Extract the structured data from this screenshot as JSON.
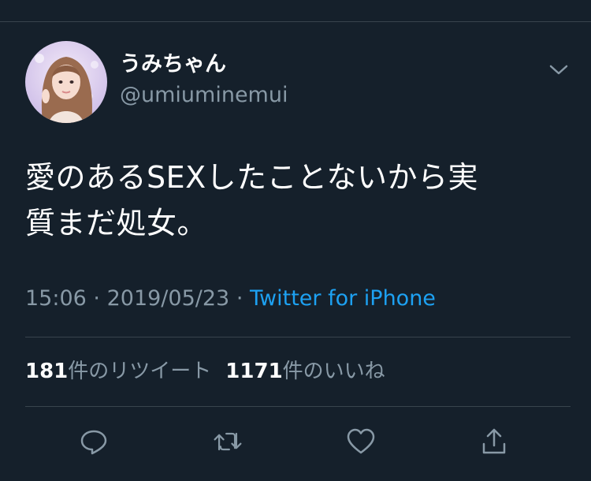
{
  "tweet": {
    "author": {
      "display_name": "うみちゃん",
      "username": "@umiuminemui"
    },
    "text_line_1": "愛のあるSEXしたことないから実",
    "text_line_2": "質まだ処女。",
    "time": "15:06",
    "separator": "·",
    "date": "2019/05/23",
    "source": "Twitter for iPhone"
  },
  "stats": {
    "retweets_count": "181",
    "retweets_label": "件のリツイート",
    "likes_count": "1171",
    "likes_label": "件のいいね"
  },
  "icons": {
    "menu": "chevron-down-icon",
    "reply": "reply-icon",
    "retweet": "retweet-icon",
    "like": "heart-icon",
    "share": "share-icon"
  },
  "colors": {
    "background": "#15202b",
    "text_primary": "#ffffff",
    "text_secondary": "#8899a6",
    "link": "#1da1f2",
    "divider": "#38444d"
  }
}
